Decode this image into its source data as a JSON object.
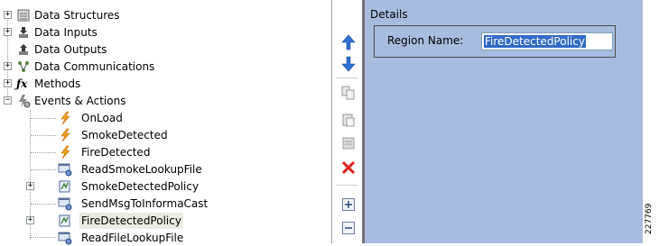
{
  "tree": {
    "items": [
      {
        "label": "Data Structures",
        "icon": "data-structures-icon",
        "expander": "+"
      },
      {
        "label": "Data Inputs",
        "icon": "data-inputs-icon",
        "expander": "+"
      },
      {
        "label": "Data Outputs",
        "icon": "data-outputs-icon",
        "expander": ""
      },
      {
        "label": "Data Communications",
        "icon": "data-communications-icon",
        "expander": "+"
      },
      {
        "label": "Methods",
        "icon": "methods-icon",
        "expander": "+"
      },
      {
        "label": "Events & Actions",
        "icon": "events-actions-icon",
        "expander": "−"
      },
      {
        "label": "OnLoad",
        "icon": "event-lightning-icon",
        "expander": ""
      },
      {
        "label": "SmokeDetected",
        "icon": "event-lightning-icon",
        "expander": ""
      },
      {
        "label": "FireDetected",
        "icon": "event-lightning-icon",
        "expander": ""
      },
      {
        "label": "ReadSmokeLookupFile",
        "icon": "action-icon",
        "expander": ""
      },
      {
        "label": "SmokeDetectedPolicy",
        "icon": "policy-icon",
        "expander": "+"
      },
      {
        "label": "SendMsgToInformaCast",
        "icon": "action-icon",
        "expander": ""
      },
      {
        "label": "FireDetectedPolicy",
        "icon": "policy-icon",
        "expander": "+"
      },
      {
        "label": "ReadFileLookupFile",
        "icon": "action-icon",
        "expander": ""
      }
    ]
  },
  "toolbar": {
    "buttons": [
      "move-up-icon",
      "move-down-icon",
      "copy-icon",
      "paste-icon",
      "properties-icon",
      "delete-icon",
      "expand-icon",
      "collapse-icon"
    ]
  },
  "details": {
    "title": "Details",
    "region_label": "Region Name:",
    "region_value": "FireDetectedPolicy"
  },
  "figure_id": "227769",
  "colors": {
    "details_bg": "#a9bbdf",
    "selection": "#316ac5",
    "delete_red": "#e0201b",
    "arrow_blue": "#2f6fd1"
  }
}
